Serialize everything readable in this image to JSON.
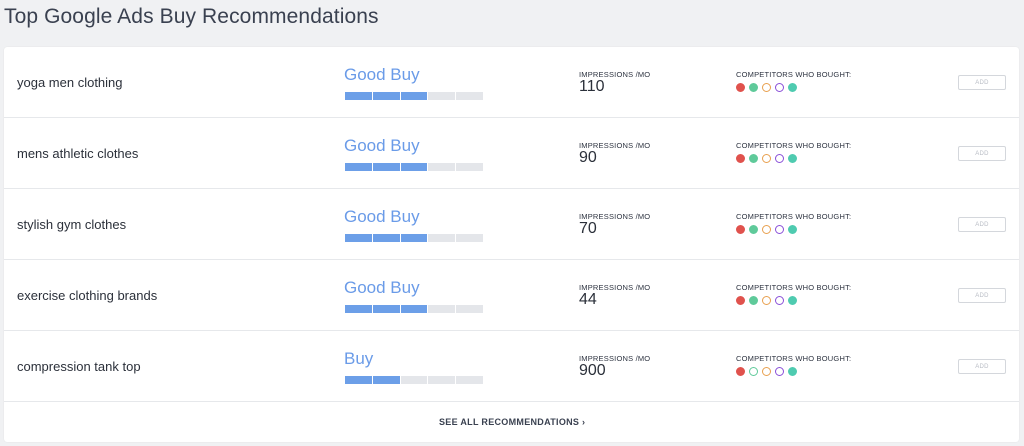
{
  "page": {
    "title": "Top Google Ads Buy Recommendations"
  },
  "labels": {
    "impressions": "IMPRESSIONS /MO",
    "competitors": "COMPETITORS WHO BOUGHT:",
    "add": "ADD",
    "see_all": "SEE ALL RECOMMENDATIONS ›"
  },
  "colors": {
    "accent": "#6c9fe8",
    "bar_empty": "#e4e6ea",
    "competitor_1": "#e0524d",
    "competitor_2": "#5fca9a",
    "competitor_3": "#e8a04f",
    "competitor_4": "#8a4fd8",
    "competitor_5": "#4fcbb0"
  },
  "rows": [
    {
      "keyword": "yoga men clothing",
      "rating": "Good Buy",
      "score_filled": 3,
      "score_total": 5,
      "impressions": "110",
      "competitors_filled": [
        true,
        true,
        false,
        false,
        true
      ]
    },
    {
      "keyword": "mens athletic clothes",
      "rating": "Good Buy",
      "score_filled": 3,
      "score_total": 5,
      "impressions": "90",
      "competitors_filled": [
        true,
        true,
        false,
        false,
        true
      ]
    },
    {
      "keyword": "stylish gym clothes",
      "rating": "Good Buy",
      "score_filled": 3,
      "score_total": 5,
      "impressions": "70",
      "competitors_filled": [
        true,
        true,
        false,
        false,
        true
      ]
    },
    {
      "keyword": "exercise clothing brands",
      "rating": "Good Buy",
      "score_filled": 3,
      "score_total": 5,
      "impressions": "44",
      "competitors_filled": [
        true,
        true,
        false,
        false,
        true
      ]
    },
    {
      "keyword": "compression tank top",
      "rating": "Buy",
      "score_filled": 2,
      "score_total": 5,
      "impressions": "900",
      "competitors_filled": [
        true,
        false,
        false,
        false,
        true
      ]
    }
  ]
}
